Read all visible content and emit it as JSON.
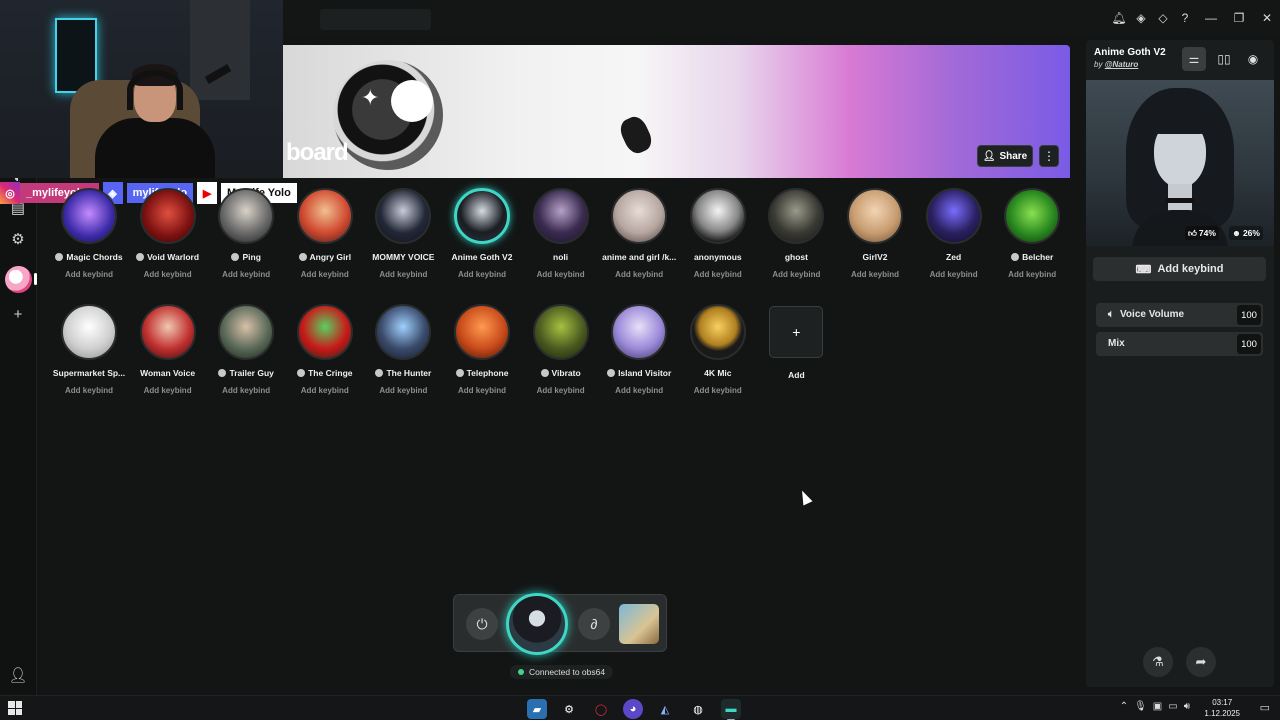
{
  "window": {
    "app_name": "Voicemod Soundboard"
  },
  "banner": {
    "title_visible": "board",
    "share_label": "Share",
    "more_label": "⋮"
  },
  "socials": {
    "instagram": "_mylifeyolo_",
    "discord": "mylifeyolo",
    "youtube": "My Life Yolo"
  },
  "voices_row1": [
    {
      "name": "Magic Chords",
      "keybind": "Add keybind",
      "badge": true
    },
    {
      "name": "Void Warlord",
      "keybind": "Add keybind",
      "badge": true
    },
    {
      "name": "Ping",
      "keybind": "Add keybind",
      "badge": true
    },
    {
      "name": "Angry Girl",
      "keybind": "Add keybind",
      "badge": true
    },
    {
      "name": "MOMMY VOICE",
      "keybind": "Add keybind",
      "badge": false
    },
    {
      "name": "Anime Goth V2",
      "keybind": "Add keybind",
      "badge": false
    },
    {
      "name": "noli",
      "keybind": "Add keybind",
      "badge": false
    },
    {
      "name": "anime and girl /k...",
      "keybind": "Add keybind",
      "badge": false
    },
    {
      "name": "anonymous",
      "keybind": "Add keybind",
      "badge": false
    },
    {
      "name": "ghost",
      "keybind": "Add keybind",
      "badge": false
    },
    {
      "name": "GirlV2",
      "keybind": "Add keybind",
      "badge": false
    },
    {
      "name": "Zed",
      "keybind": "Add keybind",
      "badge": false
    },
    {
      "name": "Belcher",
      "keybind": "Add keybind",
      "badge": true
    }
  ],
  "voices_row2": [
    {
      "name": "Supermarket Sp...",
      "keybind": "Add keybind",
      "badge": false
    },
    {
      "name": "Woman Voice",
      "keybind": "Add keybind",
      "badge": false
    },
    {
      "name": "Trailer Guy",
      "keybind": "Add keybind",
      "badge": true
    },
    {
      "name": "The Cringe",
      "keybind": "Add keybind",
      "badge": true
    },
    {
      "name": "The Hunter",
      "keybind": "Add keybind",
      "badge": true
    },
    {
      "name": "Telephone",
      "keybind": "Add keybind",
      "badge": true
    },
    {
      "name": "Vibrato",
      "keybind": "Add keybind",
      "badge": true
    },
    {
      "name": "Island Visitor",
      "keybind": "Add keybind",
      "badge": true
    },
    {
      "name": "4K Mic",
      "keybind": "Add keybind",
      "badge": false
    }
  ],
  "add_tile": {
    "label": "Add",
    "icon": "+"
  },
  "dock": {
    "status": "Connected to obs64"
  },
  "panel": {
    "title": "Anime Goth V2",
    "by_prefix": "by",
    "author": "@Naturo",
    "likes": "74%",
    "dislikes": "26%",
    "add_keybind": "Add keybind",
    "sliders": [
      {
        "label": "Voice Volume",
        "value": "100",
        "icon": "speaker-icon"
      },
      {
        "label": "Mix",
        "value": "100",
        "icon": ""
      }
    ]
  },
  "taskbar": {
    "time": "03:17",
    "date": "1.12.2025"
  },
  "colors": {
    "accent": "#40d6c6",
    "background": "#131515",
    "panel": "#1a1d1d"
  }
}
